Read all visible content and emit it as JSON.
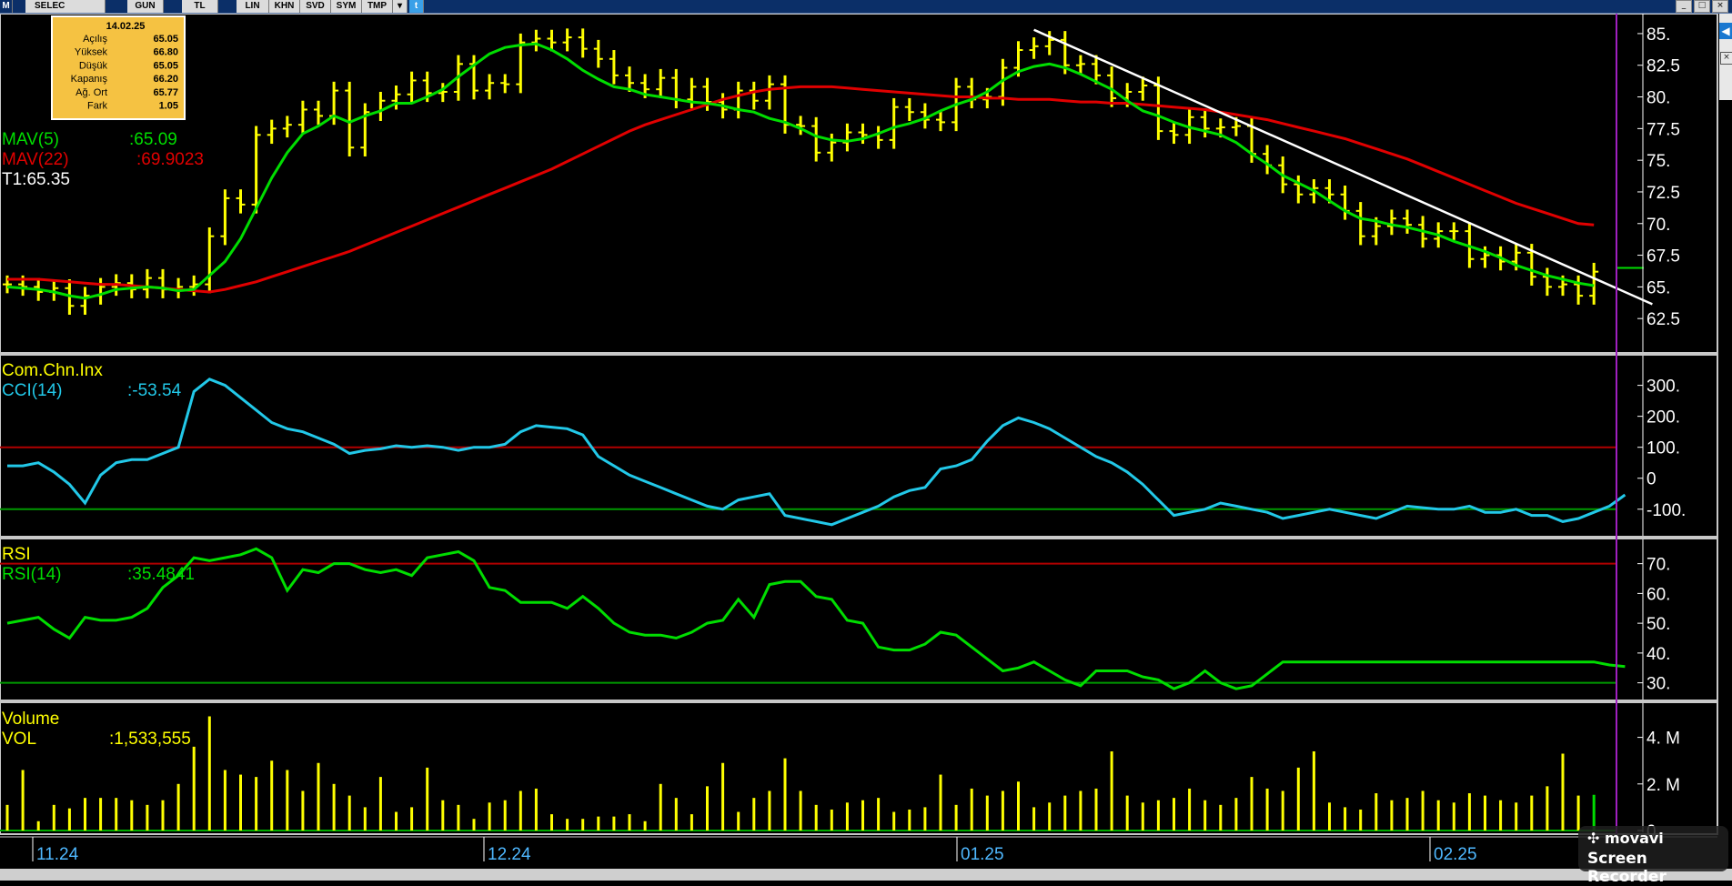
{
  "toolbar": {
    "symbol": "SELEC",
    "period": "GUN",
    "currency": "TL",
    "buttons": [
      "LIN",
      "KHN",
      "SVD",
      "SYM",
      "TMP"
    ]
  },
  "info_box": {
    "date": "14.02.25",
    "rows": [
      {
        "label": "Açılış",
        "value": "65.05"
      },
      {
        "label": "Yüksek",
        "value": "66.80"
      },
      {
        "label": "Düşük",
        "value": "65.05"
      },
      {
        "label": "Kapanış",
        "value": "66.20"
      },
      {
        "label": "Ağ. Ort",
        "value": "65.77"
      },
      {
        "label": "Fark",
        "value": "1.05"
      }
    ]
  },
  "price_panel": {
    "mav5": "MAV(5)",
    "mav5_val": ":65.09",
    "mav22": "MAV(22)",
    "mav22_val": ":69.9023",
    "t1": "T1:65.35"
  },
  "cci_panel": {
    "title": "Com.Chn.Inx",
    "label": "CCI(14)",
    "value": ":-53.54"
  },
  "rsi_panel": {
    "title": "RSI",
    "label": "RSI(14)",
    "value": ":35.4841"
  },
  "vol_panel": {
    "title": "Volume",
    "label": "VOL",
    "value": ":1,533,555"
  },
  "watermark": {
    "line1": "movavi",
    "line2": "Screen Recorder"
  },
  "colors": {
    "bars": "#ffff00",
    "mav5": "#00dd00",
    "mav22": "#e00000",
    "cci": "#22c8e8",
    "rsi": "#00dd00",
    "trend": "#ffffff",
    "cursor": "#a020c0",
    "axis_text": "#ffffff"
  },
  "chart_data": [
    {
      "type": "ohlc",
      "title": "SELEC",
      "x_labels": [
        "11.24",
        "12.24",
        "01.25",
        "02.25"
      ],
      "ylim": [
        60,
        86
      ],
      "y_ticks": [
        "62.5",
        "65.",
        "67.5",
        "70.",
        "72.5",
        "75.",
        "77.5",
        "80.",
        "82.5",
        "85."
      ],
      "close": [
        65.2,
        65.0,
        64.6,
        64.9,
        63.5,
        64.3,
        65.0,
        65.3,
        64.8,
        65.7,
        64.8,
        65.0,
        65.2,
        69.0,
        72.0,
        71.5,
        77.0,
        77.5,
        77.8,
        79.0,
        78.5,
        80.5,
        76.0,
        78.8,
        79.7,
        80.2,
        81.3,
        80.3,
        80.4,
        82.6,
        80.5,
        81.1,
        81.0,
        84.3,
        84.6,
        84.3,
        84.7,
        83.8,
        83.0,
        81.7,
        81.1,
        80.6,
        81.5,
        79.8,
        80.8,
        79.6,
        79.0,
        80.5,
        79.7,
        81.0,
        77.8,
        77.7,
        75.6,
        76.4,
        77.2,
        77.0,
        76.6,
        79.2,
        78.8,
        78.2,
        78.0,
        80.8,
        79.8,
        80.0,
        82.3,
        83.7,
        84.0,
        84.5,
        82.5,
        82.6,
        81.7,
        79.9,
        80.4,
        80.9,
        77.3,
        77.0,
        78.4,
        77.5,
        77.6,
        77.7,
        75.5,
        74.6,
        73.1,
        72.3,
        72.8,
        72.3,
        71.0,
        69.0,
        69.8,
        70.4,
        69.9,
        68.8,
        69.4,
        69.4,
        67.2,
        67.5,
        67.0,
        67.7,
        65.8,
        65.0,
        65.2,
        64.3,
        66.2
      ],
      "series": [
        {
          "name": "MAV(5)",
          "values": [
            65.0,
            64.9,
            64.8,
            64.6,
            64.3,
            64.1,
            64.4,
            64.8,
            64.9,
            65.0,
            64.9,
            64.7,
            64.8,
            65.9,
            67.0,
            68.8,
            71.2,
            73.6,
            75.6,
            77.1,
            77.7,
            78.5,
            78.0,
            78.5,
            78.9,
            79.5,
            79.5,
            80.0,
            80.6,
            81.6,
            82.5,
            83.4,
            83.9,
            84.1,
            84.2,
            83.7,
            83.0,
            82.1,
            81.4,
            80.8,
            80.6,
            80.2,
            80.0,
            79.8,
            79.6,
            79.5,
            79.3,
            79.0,
            78.8,
            78.3,
            78.0,
            77.5,
            76.9,
            76.6,
            76.5,
            76.7,
            77.1,
            77.6,
            77.9,
            78.3,
            78.9,
            79.4,
            79.8,
            80.4,
            81.3,
            82.0,
            82.4,
            82.6,
            82.3,
            81.8,
            81.2,
            80.6,
            79.7,
            78.9,
            78.5,
            78.0,
            77.6,
            77.3,
            77.0,
            76.4,
            75.5,
            74.7,
            73.8,
            73.2,
            72.6,
            71.8,
            71.0,
            70.4,
            70.2,
            69.9,
            69.7,
            69.4,
            69.1,
            68.6,
            68.2,
            67.8,
            67.3,
            66.7,
            66.3,
            65.9,
            65.6,
            65.3,
            65.1
          ]
        },
        {
          "name": "MAV(22)",
          "values": [
            65.6,
            65.6,
            65.6,
            65.5,
            65.4,
            65.3,
            65.2,
            65.2,
            65.1,
            65.0,
            64.9,
            64.8,
            64.7,
            64.6,
            64.8,
            65.1,
            65.4,
            65.8,
            66.2,
            66.6,
            67.0,
            67.4,
            67.8,
            68.3,
            68.8,
            69.3,
            69.8,
            70.3,
            70.8,
            71.3,
            71.8,
            72.3,
            72.8,
            73.3,
            73.8,
            74.3,
            74.9,
            75.5,
            76.1,
            76.7,
            77.3,
            77.8,
            78.2,
            78.6,
            79.0,
            79.4,
            79.8,
            80.1,
            80.4,
            80.6,
            80.7,
            80.8,
            80.8,
            80.8,
            80.7,
            80.6,
            80.5,
            80.4,
            80.3,
            80.2,
            80.1,
            80.0,
            80.0,
            79.9,
            79.9,
            79.8,
            79.8,
            79.8,
            79.7,
            79.6,
            79.6,
            79.5,
            79.5,
            79.4,
            79.3,
            79.2,
            79.1,
            79.0,
            78.8,
            78.6,
            78.4,
            78.2,
            77.9,
            77.6,
            77.3,
            77.0,
            76.7,
            76.3,
            75.9,
            75.5,
            75.1,
            74.6,
            74.1,
            73.6,
            73.1,
            72.6,
            72.1,
            71.6,
            71.2,
            70.8,
            70.4,
            70.0,
            69.9
          ]
        }
      ],
      "trendline": {
        "from": {
          "bar": 66,
          "value": 85.3
        },
        "to": {
          "bar": 104,
          "value": 64.5
        }
      }
    },
    {
      "type": "line",
      "title": "Com.Chn.Inx",
      "y_ticks": [
        "300.",
        "200.",
        "100.",
        "0",
        "-100."
      ],
      "ylim": [
        -180,
        340
      ],
      "reference_lines": [
        100,
        -100
      ],
      "series": [
        {
          "name": "CCI(14)",
          "values": [
            40,
            40,
            50,
            20,
            -20,
            -80,
            10,
            50,
            60,
            60,
            80,
            100,
            280,
            320,
            300,
            260,
            220,
            180,
            160,
            150,
            130,
            110,
            80,
            90,
            95,
            105,
            100,
            105,
            100,
            90,
            100,
            100,
            110,
            150,
            170,
            165,
            160,
            140,
            70,
            40,
            10,
            -10,
            -30,
            -50,
            -70,
            -90,
            -100,
            -70,
            -60,
            -50,
            -120,
            -130,
            -140,
            -150,
            -130,
            -110,
            -90,
            -60,
            -40,
            -30,
            30,
            40,
            60,
            120,
            170,
            195,
            180,
            160,
            130,
            100,
            70,
            50,
            20,
            -20,
            -70,
            -120,
            -110,
            -100,
            -80,
            -90,
            -100,
            -110,
            -130,
            -120,
            -110,
            -100,
            -110,
            -120,
            -130,
            -110,
            -90,
            -95,
            -100,
            -100,
            -90,
            -110,
            -110,
            -100,
            -120,
            -120,
            -140,
            -130,
            -110,
            -90,
            -53.54
          ]
        }
      ]
    },
    {
      "type": "line",
      "title": "RSI",
      "y_ticks": [
        "70.",
        "60.",
        "50.",
        "40.",
        "30."
      ],
      "ylim": [
        25,
        76
      ],
      "reference_lines": [
        70,
        30
      ],
      "series": [
        {
          "name": "RSI(14)",
          "values": [
            50,
            51,
            52,
            48,
            45,
            52,
            51,
            51,
            52,
            55,
            62,
            66,
            72,
            71,
            72,
            73,
            75,
            72,
            61,
            68,
            67,
            70,
            70,
            68,
            67,
            68,
            66,
            72,
            73,
            74,
            71,
            62,
            61,
            57,
            57,
            57,
            55,
            59,
            55,
            50,
            47,
            46,
            46,
            45,
            47,
            50,
            51,
            58,
            52,
            63,
            64,
            64,
            59,
            58,
            51,
            50,
            42,
            41,
            41,
            43,
            47,
            46,
            42,
            38,
            34,
            35,
            37,
            34,
            31,
            29,
            34,
            34,
            34,
            32,
            31,
            28,
            30,
            34,
            30,
            28,
            29,
            33,
            37,
            37,
            37,
            37,
            37,
            37,
            37,
            37,
            37,
            37,
            37,
            37,
            37,
            37,
            37,
            37,
            37,
            37,
            37,
            37,
            37,
            36,
            35.48
          ]
        }
      ]
    },
    {
      "type": "bar",
      "title": "Volume",
      "y_ticks": [
        "4. M",
        "2. M",
        "0"
      ],
      "ylim": [
        0,
        5000000
      ],
      "series": [
        {
          "name": "VOL",
          "values": [
            1100000,
            2600000,
            400000,
            1100000,
            950000,
            1400000,
            1400000,
            1400000,
            1300000,
            1100000,
            1300000,
            2000000,
            3600000,
            4900000,
            2600000,
            2400000,
            2300000,
            3000000,
            2600000,
            1700000,
            2900000,
            2000000,
            1500000,
            1000000,
            2300000,
            800000,
            1000000,
            2700000,
            1300000,
            1100000,
            500000,
            1200000,
            1300000,
            1700000,
            1800000,
            700000,
            500000,
            500000,
            600000,
            600000,
            700000,
            400000,
            2000000,
            1400000,
            700000,
            1900000,
            2900000,
            800000,
            1400000,
            1700000,
            3100000,
            1700000,
            1100000,
            900000,
            1200000,
            1300000,
            1400000,
            800000,
            900000,
            1000000,
            2400000,
            1100000,
            1800000,
            1500000,
            1700000,
            2100000,
            1000000,
            1200000,
            1500000,
            1700000,
            1800000,
            3400000,
            1500000,
            1200000,
            1300000,
            1400000,
            1800000,
            1300000,
            1100000,
            1400000,
            2300000,
            1800000,
            1700000,
            2700000,
            3400000,
            1200000,
            1000000,
            900000,
            1600000,
            1300000,
            1400000,
            1700000,
            1300000,
            1200000,
            1600000,
            1500000,
            1300000,
            1200000,
            1500000,
            1900000,
            3300000,
            1500000,
            1533555
          ]
        }
      ]
    }
  ]
}
